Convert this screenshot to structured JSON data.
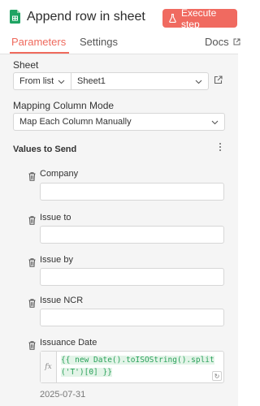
{
  "header": {
    "title": "Append row in sheet",
    "execute_label": "Execute step"
  },
  "tabs": [
    {
      "label": "Parameters",
      "active": true
    },
    {
      "label": "Settings",
      "active": false
    },
    {
      "label": "Docs",
      "active": false
    }
  ],
  "sheet": {
    "label": "Sheet",
    "mode_value": "From list",
    "sheet_value": "Sheet1"
  },
  "mapping": {
    "label": "Mapping Column Mode",
    "value": "Map Each Column Manually"
  },
  "values": {
    "label": "Values to Send",
    "fields": [
      {
        "label": "Company",
        "value": ""
      },
      {
        "label": "Issue to",
        "value": ""
      },
      {
        "label": "Issue by",
        "value": ""
      },
      {
        "label": "Issue NCR",
        "value": ""
      }
    ],
    "date_field": {
      "label": "Issuance Date",
      "fx_label": "fx",
      "expression_line1": "{{ new Date().toISOString().split",
      "expression_line2": "('T')[0] }}",
      "result": "2025-07-31"
    }
  },
  "colors": {
    "accent": "#ef6a5d",
    "execute_bg": "#f06a60",
    "expression_green": "#2aa15a",
    "sheets_green": "#1fa463"
  }
}
